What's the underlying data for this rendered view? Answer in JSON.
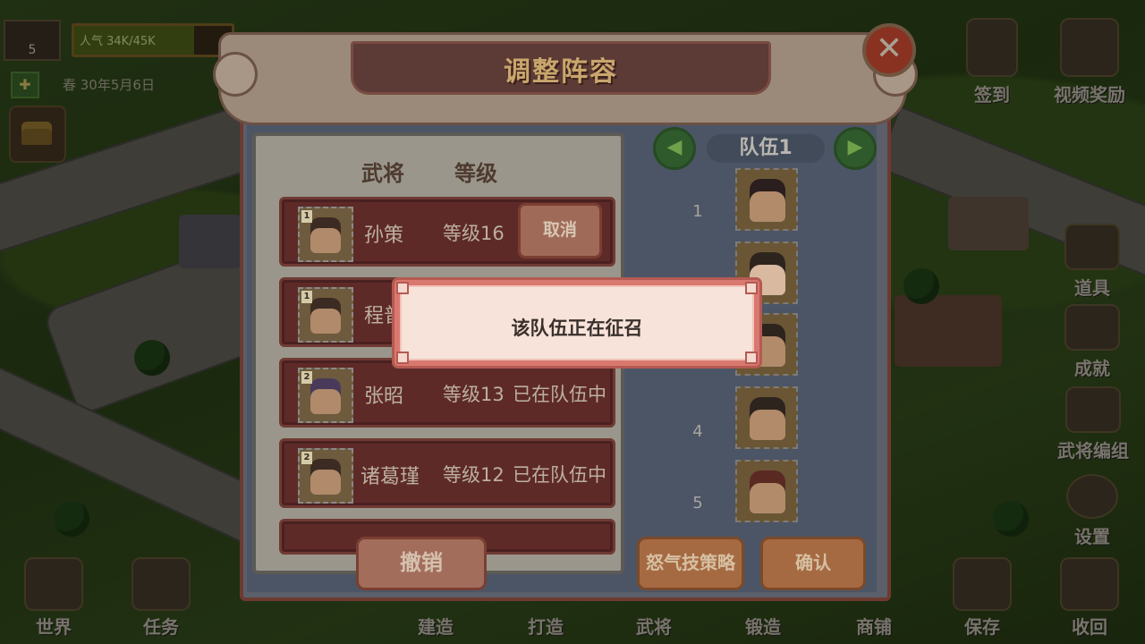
{
  "hud": {
    "level": "5",
    "popularity": "人气 34K/45K",
    "popularity_fraction": 0.76,
    "date": "春 30年5月6日"
  },
  "side_menu": {
    "sign_in": "签到",
    "video_reward": "视频奖励",
    "items": "道具",
    "achievements": "成就",
    "general_team": "武将编组",
    "settings": "设置"
  },
  "bottom_menu": {
    "world": "世界",
    "tasks": "任务",
    "build": "建造",
    "forge": "打造",
    "generals": "武将",
    "smith": "锻造",
    "shop": "商铺",
    "save": "保存",
    "collect": "收回"
  },
  "dialog": {
    "title": "调整阵容",
    "close_icon": "close-x-icon",
    "columns": {
      "general": "武将",
      "level": "等级"
    },
    "generals": [
      {
        "name": "孙策",
        "level": "等级16",
        "rank": "1",
        "action": "取消"
      },
      {
        "name": "程普",
        "rank": "1"
      },
      {
        "name": "张昭",
        "level": "等级13",
        "rank": "2",
        "status": "已在队伍中"
      },
      {
        "name": "诸葛瑾",
        "level": "等级12",
        "rank": "2",
        "status": "已在队伍中"
      }
    ],
    "revoke_button": "撤销",
    "team": {
      "label": "队伍1",
      "prev_icon": "arrow-left-icon",
      "next_icon": "arrow-right-icon",
      "slot_numbers": [
        "1",
        "4",
        "5"
      ]
    },
    "rage_skill_button": "怒气技策略",
    "confirm_button": "确认"
  },
  "toast": {
    "message": "该队伍正在征召"
  },
  "colors": {
    "toast_border": "#d9786e",
    "row_bg": "#5e2a28",
    "accent_green": "#2f5a2c"
  }
}
